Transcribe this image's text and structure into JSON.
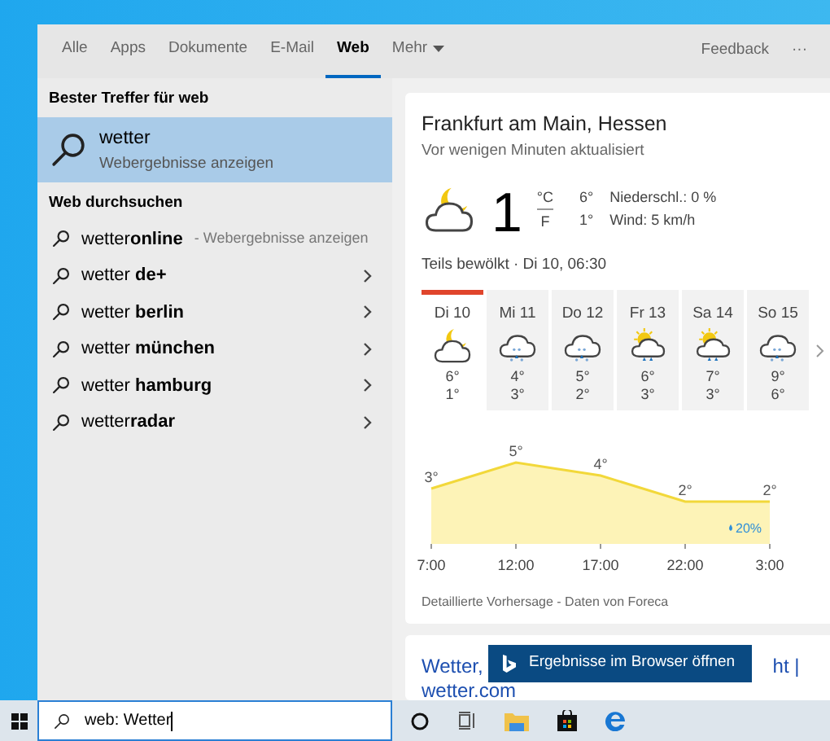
{
  "tabs": [
    {
      "label": "Alle",
      "selected": false
    },
    {
      "label": "Apps",
      "selected": false
    },
    {
      "label": "Dokumente",
      "selected": false
    },
    {
      "label": "E-Mail",
      "selected": false
    },
    {
      "label": "Web",
      "selected": true
    },
    {
      "label": "Mehr",
      "selected": false,
      "kind": "dropdown"
    }
  ],
  "feedback": "Feedback",
  "more": "···",
  "best_match": {
    "heading": "Bester Treffer für web",
    "title": "wetter",
    "subtitle": "Webergebnisse anzeigen",
    "selected": true
  },
  "web_search": {
    "heading": "Web durchsuchen",
    "items": [
      {
        "text": "wetter**online**",
        "hint": " - Webergebnisse anzeigen"
      },
      {
        "text": "wetter **de+**"
      },
      {
        "text": "wetter **berlin**"
      },
      {
        "text": "wetter **münchen**"
      },
      {
        "text": "wetter **hamburg**"
      },
      {
        "text": "wetter**radar**"
      }
    ]
  },
  "weather": {
    "location": "Frankfurt am Main, Hessen",
    "updated": "Vor wenigen Minuten aktualisiert",
    "temp": "1",
    "unit_c": "°C",
    "unit_f": "F",
    "high": "6°",
    "low": "1°",
    "precip": "Niederschl.: 0 %",
    "wind": "Wind: 5 km/h",
    "condition": "Teils bewölkt · Di 10, 06:30",
    "days": [
      {
        "day": "Di 10",
        "kind": "moon-cloud",
        "high": "6°",
        "low": "1°",
        "selected": true
      },
      {
        "day": "Mi 11",
        "kind": "snow-cloud",
        "high": "4°",
        "low": "3°",
        "selected": false
      },
      {
        "day": "Do 12",
        "kind": "snow-cloud",
        "high": "5°",
        "low": "2°",
        "selected": false
      },
      {
        "day": "Fr 13",
        "kind": "sun-rain",
        "high": "6°",
        "low": "3°",
        "selected": false
      },
      {
        "day": "Sa 14",
        "kind": "sun-rain",
        "high": "7°",
        "low": "3°",
        "selected": false
      },
      {
        "day": "So 15",
        "kind": "snow-cloud",
        "high": "9°",
        "low": "6°",
        "selected": false
      }
    ],
    "chart_data": {
      "type": "area",
      "categories": [
        "7:00",
        "12:00",
        "17:00",
        "22:00",
        "3:00"
      ],
      "values": [
        3,
        5,
        4,
        2,
        2
      ],
      "value_labels": [
        "3°",
        "5°",
        "4°",
        "2°",
        "2°"
      ],
      "annotations": [
        "20%"
      ]
    },
    "footer": "Detaillierte Vorhersage - Daten von Foreca"
  },
  "result": {
    "link_start": "Wetter,",
    "link_end": "ht |",
    "link_line2": "wetter.com"
  },
  "tooltip": "Ergebnisse im Browser öffnen",
  "search_box": {
    "value": "web: Wetter"
  }
}
